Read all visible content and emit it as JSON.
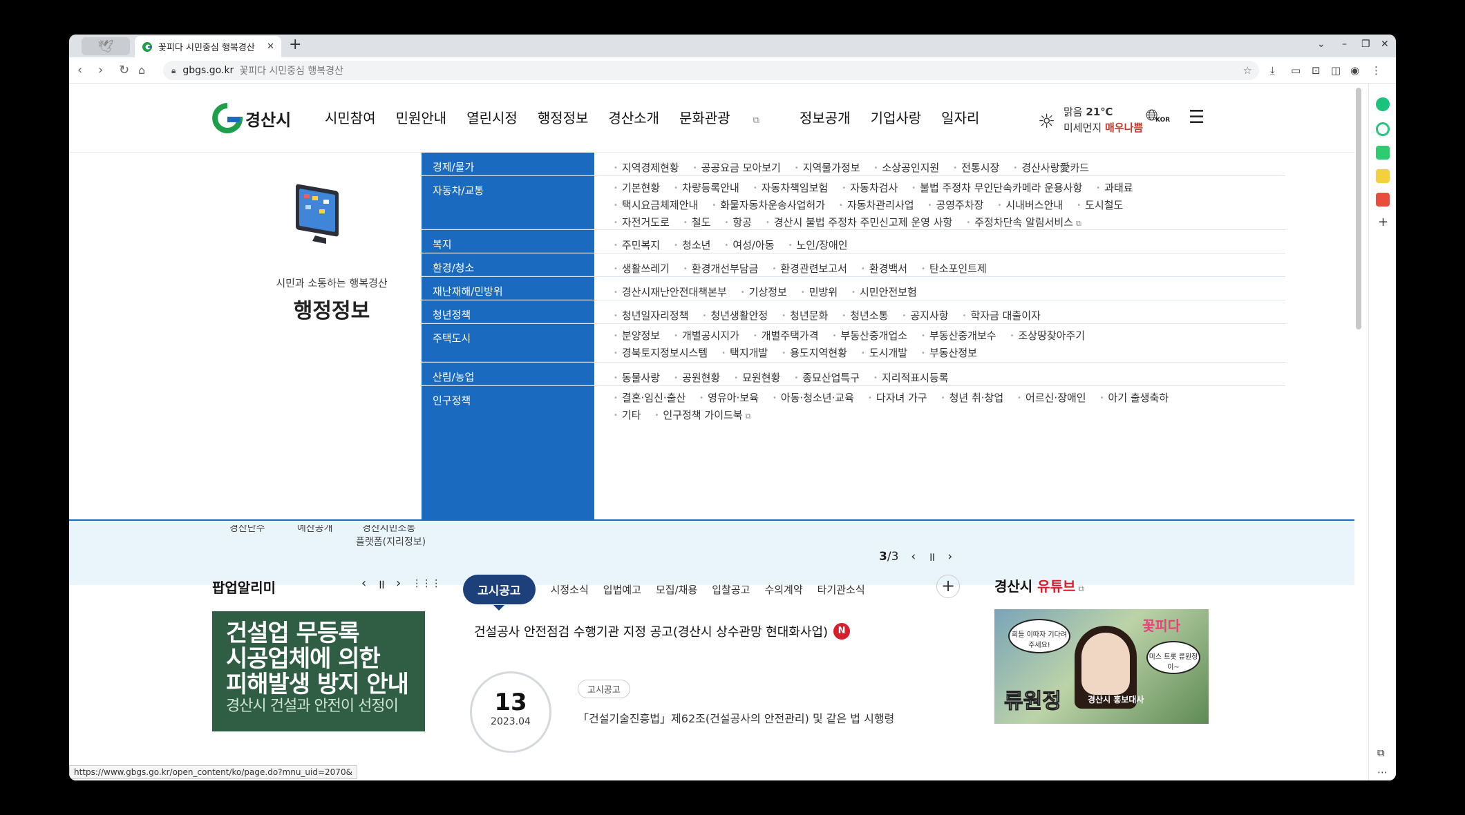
{
  "browser": {
    "tab_title": "꽃피다 시민중심 행복경산",
    "url": "gbgs.go.kr",
    "page_title": "꽃피다 시민중심 행복경산",
    "status_url": "https://www.gbgs.go.kr/open_content/ko/page.do?mnu_uid=2070&"
  },
  "header": {
    "logo_text": "경산시",
    "nav": [
      "시민참여",
      "민원안내",
      "열린시정",
      "행정정보",
      "경산소개",
      "문화관광",
      "정보공개",
      "기업사랑",
      "일자리"
    ],
    "weather_cond": "맑음",
    "temp": "21℃",
    "dust_label": "미세먼지",
    "dust_value": "매우나쁨",
    "lang": "KOR"
  },
  "mega": {
    "subtitle": "시민과 소통하는 행복경산",
    "title": "행정정보",
    "rows": [
      {
        "cat": "경제/물가",
        "links": [
          "지역경제현황",
          "공공요금 모아보기",
          "지역물가정보",
          "소상공인지원",
          "전통시장",
          "경산사랑愛카드"
        ]
      },
      {
        "cat": "자동차/교통",
        "links": [
          "기본현황",
          "차량등록안내",
          "자동차책임보험",
          "자동차검사",
          "불법 주정차 무인단속카메라 운용사항",
          "과태료",
          "택시요금체제안내",
          "화물자동차운송사업허가",
          "자동차관리사업",
          "공영주차장",
          "시내버스안내",
          "도시철도",
          "자전거도로",
          "철도",
          "항공",
          "경산시 불법 주정차 주민신고제 운영 사항",
          "주정차단속 알림서비스"
        ]
      },
      {
        "cat": "복지",
        "links": [
          "주민복지",
          "청소년",
          "여성/아동",
          "노인/장애인"
        ]
      },
      {
        "cat": "환경/청소",
        "links": [
          "생활쓰레기",
          "환경개선부담금",
          "환경관련보고서",
          "환경백서",
          "탄소포인트제"
        ]
      },
      {
        "cat": "재난재해/민방위",
        "links": [
          "경산시재난안전대책본부",
          "기상정보",
          "민방위",
          "시민안전보험"
        ]
      },
      {
        "cat": "청년정책",
        "links": [
          "청년일자리정책",
          "청년생활안정",
          "청년문화",
          "청년소통",
          "공지사항",
          "학자금 대출이자"
        ]
      },
      {
        "cat": "주택도시",
        "links": [
          "분양정보",
          "개별공시지가",
          "개별주택가격",
          "부동산중개업소",
          "부동산중개보수",
          "조상땅찾아주기",
          "경북토지정보시스템",
          "택지개발",
          "용도지역현황",
          "도시개발",
          "부동산정보"
        ]
      },
      {
        "cat": "산림/농업",
        "links": [
          "동물사랑",
          "공원현황",
          "묘원현황",
          "종묘산업특구",
          "지리적표시등록"
        ]
      },
      {
        "cat": "인구정책",
        "links": [
          "결혼·임신·출산",
          "영유아·보육",
          "아동·청소년·교육",
          "다자녀 가구",
          "청년 취·창업",
          "어르신·장애인",
          "아기 출생축하",
          "기타",
          "인구정책 가이드북"
        ]
      }
    ]
  },
  "band": {
    "partial1": "경산단수",
    "partial2": "예산공개",
    "partial3": "경산시민소통",
    "platform": "플랫폼(지리정보)",
    "page_current": "3",
    "page_total": "/3"
  },
  "popup": {
    "heading": "팝업알리미",
    "line1": "건설업 무등록",
    "line2": "시공업체에 의한",
    "line3": "피해발생 방지 안내",
    "line4": "경산시 건설과 안전이 선정이"
  },
  "notice": {
    "active_tab": "고시공고",
    "tabs": [
      "시정소식",
      "입법예고",
      "모집/채용",
      "입찰공고",
      "수의계약",
      "타기관소식"
    ],
    "title": "건설공사 안전점검 수행기관 지정 공고(경산시 상수관망 현대화사업)",
    "new_badge": "N",
    "day": "13",
    "yearmonth": "2023.04",
    "chip": "고시공고",
    "excerpt": "「건설기술진흥법」제62조(건설공사의 안전관리) 및 같은 법 시행령"
  },
  "youtube": {
    "heading_a": "경산시 ",
    "heading_b": "유튜브",
    "name": "류원정",
    "subname": "경산시 홍보대사",
    "bubble1": "희들 이따자 기다려주세요!",
    "bubble2": "미스 트롯 류원정이~",
    "flower": "꽃피다"
  },
  "colors": {
    "accent": "#1a6bbf",
    "dark_blue": "#1d3f7a",
    "red": "#d81e2c",
    "band": "#eaf4fb"
  }
}
